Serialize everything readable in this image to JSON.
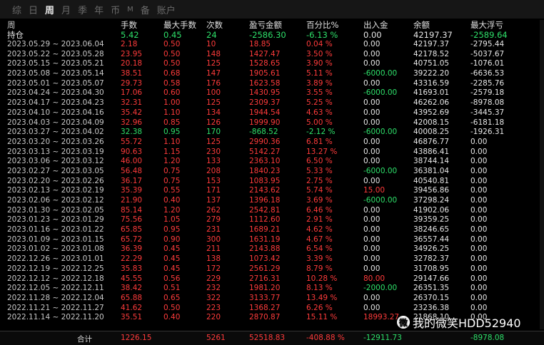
{
  "tabs": [
    "综",
    "日",
    "周",
    "月",
    "季",
    "年",
    "币",
    "M",
    "备",
    "账户"
  ],
  "active_tab": "周",
  "headers": [
    "周",
    "手数",
    "最大手数",
    "次数",
    "盈亏金额",
    "百分比%",
    "出入金",
    "余额",
    "最大浮亏"
  ],
  "holding": {
    "label": "持仓",
    "lots": "5.42",
    "max_lots": "0.45",
    "count": "24",
    "pnl": "-2586.30",
    "pct": "-6.13 %",
    "io": "0.00",
    "balance": "42197.37",
    "max_float": "-2589.64"
  },
  "rows": [
    {
      "period": "2023.05.29 ~ 2023.06.04",
      "lots": "2.18",
      "max_lots": "0.50",
      "count": "10",
      "pnl": "18.85",
      "pct": "0.04 %",
      "io": "0.00",
      "balance": "42197.37",
      "max_float": "-2795.44",
      "sign": "pos",
      "io_color": "white"
    },
    {
      "period": "2023.05.22 ~ 2023.05.28",
      "lots": "23.95",
      "max_lots": "0.50",
      "count": "148",
      "pnl": "1427.47",
      "pct": "3.50 %",
      "io": "0.00",
      "balance": "42178.52",
      "max_float": "-5037.67",
      "sign": "pos",
      "io_color": "white"
    },
    {
      "period": "2023.05.15 ~ 2023.05.21",
      "lots": "20.18",
      "max_lots": "0.50",
      "count": "125",
      "pnl": "1528.65",
      "pct": "3.90 %",
      "io": "0.00",
      "balance": "40751.05",
      "max_float": "-1076.01",
      "sign": "pos",
      "io_color": "white"
    },
    {
      "period": "2023.05.08 ~ 2023.05.14",
      "lots": "38.51",
      "max_lots": "0.68",
      "count": "147",
      "pnl": "1905.61",
      "pct": "5.11 %",
      "io": "-6000.00",
      "balance": "39222.20",
      "max_float": "-6636.53",
      "sign": "pos",
      "io_color": "green"
    },
    {
      "period": "2023.05.01 ~ 2023.05.07",
      "lots": "29.73",
      "max_lots": "0.58",
      "count": "176",
      "pnl": "1623.58",
      "pct": "3.89 %",
      "io": "0.00",
      "balance": "43316.59",
      "max_float": "-2285.76",
      "sign": "pos",
      "io_color": "white"
    },
    {
      "period": "2023.04.24 ~ 2023.04.30",
      "lots": "17.06",
      "max_lots": "0.60",
      "count": "100",
      "pnl": "1430.95",
      "pct": "3.55 %",
      "io": "-6000.00",
      "balance": "41693.01",
      "max_float": "-2579.18",
      "sign": "pos",
      "io_color": "green"
    },
    {
      "period": "2023.04.17 ~ 2023.04.23",
      "lots": "32.31",
      "max_lots": "1.00",
      "count": "125",
      "pnl": "2309.37",
      "pct": "5.25 %",
      "io": "0.00",
      "balance": "46262.06",
      "max_float": "-8978.08",
      "sign": "pos",
      "io_color": "white"
    },
    {
      "period": "2023.04.10 ~ 2023.04.16",
      "lots": "35.42",
      "max_lots": "1.10",
      "count": "134",
      "pnl": "1944.54",
      "pct": "4.63 %",
      "io": "0.00",
      "balance": "43952.69",
      "max_float": "-3445.37",
      "sign": "pos",
      "io_color": "white"
    },
    {
      "period": "2023.04.03 ~ 2023.04.09",
      "lots": "32.96",
      "max_lots": "0.85",
      "count": "126",
      "pnl": "1999.90",
      "pct": "5.00 %",
      "io": "0.00",
      "balance": "42008.15",
      "max_float": "-6181.18",
      "sign": "pos",
      "io_color": "white"
    },
    {
      "period": "2023.03.27 ~ 2023.04.02",
      "lots": "32.38",
      "max_lots": "0.95",
      "count": "170",
      "pnl": "-868.52",
      "pct": "-2.12 %",
      "io": "-6000.00",
      "balance": "40008.25",
      "max_float": "-1926.31",
      "sign": "neg",
      "io_color": "green"
    },
    {
      "period": "2023.03.20 ~ 2023.03.26",
      "lots": "55.72",
      "max_lots": "1.10",
      "count": "125",
      "pnl": "2990.36",
      "pct": "6.81 %",
      "io": "0.00",
      "balance": "46876.77",
      "max_float": "0.00",
      "sign": "pos",
      "io_color": "white"
    },
    {
      "period": "2023.03.13 ~ 2023.03.19",
      "lots": "90.63",
      "max_lots": "1.15",
      "count": "230",
      "pnl": "5142.27",
      "pct": "13.27 %",
      "io": "0.00",
      "balance": "43886.41",
      "max_float": "0.00",
      "sign": "pos",
      "io_color": "white"
    },
    {
      "period": "2023.03.06 ~ 2023.03.12",
      "lots": "46.00",
      "max_lots": "1.20",
      "count": "133",
      "pnl": "2363.10",
      "pct": "6.50 %",
      "io": "0.00",
      "balance": "38744.14",
      "max_float": "0.00",
      "sign": "pos",
      "io_color": "white"
    },
    {
      "period": "2023.02.27 ~ 2023.03.05",
      "lots": "56.48",
      "max_lots": "0.75",
      "count": "208",
      "pnl": "1840.23",
      "pct": "5.33 %",
      "io": "-6000.00",
      "balance": "36381.04",
      "max_float": "0.00",
      "sign": "pos",
      "io_color": "green"
    },
    {
      "period": "2023.02.20 ~ 2023.02.26",
      "lots": "36.17",
      "max_lots": "0.75",
      "count": "153",
      "pnl": "1083.95",
      "pct": "2.75 %",
      "io": "0.00",
      "balance": "40540.81",
      "max_float": "0.00",
      "sign": "pos",
      "io_color": "white"
    },
    {
      "period": "2023.02.13 ~ 2023.02.19",
      "lots": "35.39",
      "max_lots": "0.55",
      "count": "171",
      "pnl": "2143.62",
      "pct": "5.74 %",
      "io": "15.00",
      "balance": "39456.86",
      "max_float": "0.00",
      "sign": "pos",
      "io_color": "red"
    },
    {
      "period": "2023.02.06 ~ 2023.02.12",
      "lots": "21.90",
      "max_lots": "0.40",
      "count": "137",
      "pnl": "1396.18",
      "pct": "3.69 %",
      "io": "-6000.00",
      "balance": "37298.24",
      "max_float": "0.00",
      "sign": "pos",
      "io_color": "green"
    },
    {
      "period": "2023.01.30 ~ 2023.02.05",
      "lots": "85.14",
      "max_lots": "1.20",
      "count": "262",
      "pnl": "2542.81",
      "pct": "6.46 %",
      "io": "0.00",
      "balance": "41902.06",
      "max_float": "0.00",
      "sign": "pos",
      "io_color": "white"
    },
    {
      "period": "2023.01.23 ~ 2023.01.29",
      "lots": "75.56",
      "max_lots": "1.05",
      "count": "279",
      "pnl": "1112.60",
      "pct": "2.91 %",
      "io": "0.00",
      "balance": "39359.25",
      "max_float": "0.00",
      "sign": "pos",
      "io_color": "white"
    },
    {
      "period": "2023.01.16 ~ 2023.01.22",
      "lots": "65.85",
      "max_lots": "0.95",
      "count": "231",
      "pnl": "1689.21",
      "pct": "4.62 %",
      "io": "0.00",
      "balance": "38246.65",
      "max_float": "0.00",
      "sign": "pos",
      "io_color": "white"
    },
    {
      "period": "2023.01.09 ~ 2023.01.15",
      "lots": "65.72",
      "max_lots": "0.90",
      "count": "300",
      "pnl": "1631.19",
      "pct": "4.67 %",
      "io": "0.00",
      "balance": "36557.44",
      "max_float": "0.00",
      "sign": "pos",
      "io_color": "white"
    },
    {
      "period": "2023.01.02 ~ 2023.01.08",
      "lots": "36.39",
      "max_lots": "0.45",
      "count": "211",
      "pnl": "2143.88",
      "pct": "6.54 %",
      "io": "0.00",
      "balance": "34926.25",
      "max_float": "0.00",
      "sign": "pos",
      "io_color": "white"
    },
    {
      "period": "2022.12.26 ~ 2023.01.01",
      "lots": "22.29",
      "max_lots": "0.45",
      "count": "138",
      "pnl": "1073.42",
      "pct": "3.39 %",
      "io": "0.00",
      "balance": "32782.37",
      "max_float": "0.00",
      "sign": "pos",
      "io_color": "white"
    },
    {
      "period": "2022.12.19 ~ 2022.12.25",
      "lots": "35.83",
      "max_lots": "0.45",
      "count": "172",
      "pnl": "2561.29",
      "pct": "8.79 %",
      "io": "0.00",
      "balance": "31708.95",
      "max_float": "0.00",
      "sign": "pos",
      "io_color": "white"
    },
    {
      "period": "2022.12.12 ~ 2022.12.18",
      "lots": "45.55",
      "max_lots": "0.56",
      "count": "229",
      "pnl": "2716.31",
      "pct": "10.28 %",
      "io": "80.00",
      "balance": "29147.66",
      "max_float": "0.00",
      "sign": "pos",
      "io_color": "red"
    },
    {
      "period": "2022.12.05 ~ 2022.12.11",
      "lots": "38.42",
      "max_lots": "0.51",
      "count": "232",
      "pnl": "1981.20",
      "pct": "8.13 %",
      "io": "-2000.00",
      "balance": "26351.35",
      "max_float": "0.00",
      "sign": "pos",
      "io_color": "green"
    },
    {
      "period": "2022.11.28 ~ 2022.12.04",
      "lots": "65.88",
      "max_lots": "0.65",
      "count": "322",
      "pnl": "3133.77",
      "pct": "13.49 %",
      "io": "0.00",
      "balance": "26370.15",
      "max_float": "0.00",
      "sign": "pos",
      "io_color": "white"
    },
    {
      "period": "2022.11.21 ~ 2022.11.27",
      "lots": "41.62",
      "max_lots": "0.50",
      "count": "223",
      "pnl": "1368.27",
      "pct": "6.26 %",
      "io": "0.00",
      "balance": "23236.38",
      "max_float": "0.00",
      "sign": "pos",
      "io_color": "white"
    },
    {
      "period": "2022.11.14 ~ 2022.11.20",
      "lots": "35.51",
      "max_lots": "0.40",
      "count": "220",
      "pnl": "2870.87",
      "pct": "15.11 %",
      "io": "18993.27",
      "balance": "21868.10",
      "max_float": "0.00",
      "sign": "pos",
      "io_color": "red"
    }
  ],
  "total": {
    "label": "合计",
    "lots": "1226.15",
    "count": "5261",
    "pnl": "52518.83",
    "pct": "-408.88 %",
    "io": "-12911.73",
    "max_float": "-8978.08"
  },
  "watermark": {
    "icon": "weibo-icon",
    "text": "我的微笑HDD52940"
  },
  "colors": {
    "positive": "#ff3b3b",
    "negative": "#2ee06a",
    "neutral": "#e8e8e8",
    "background": "#000000"
  }
}
